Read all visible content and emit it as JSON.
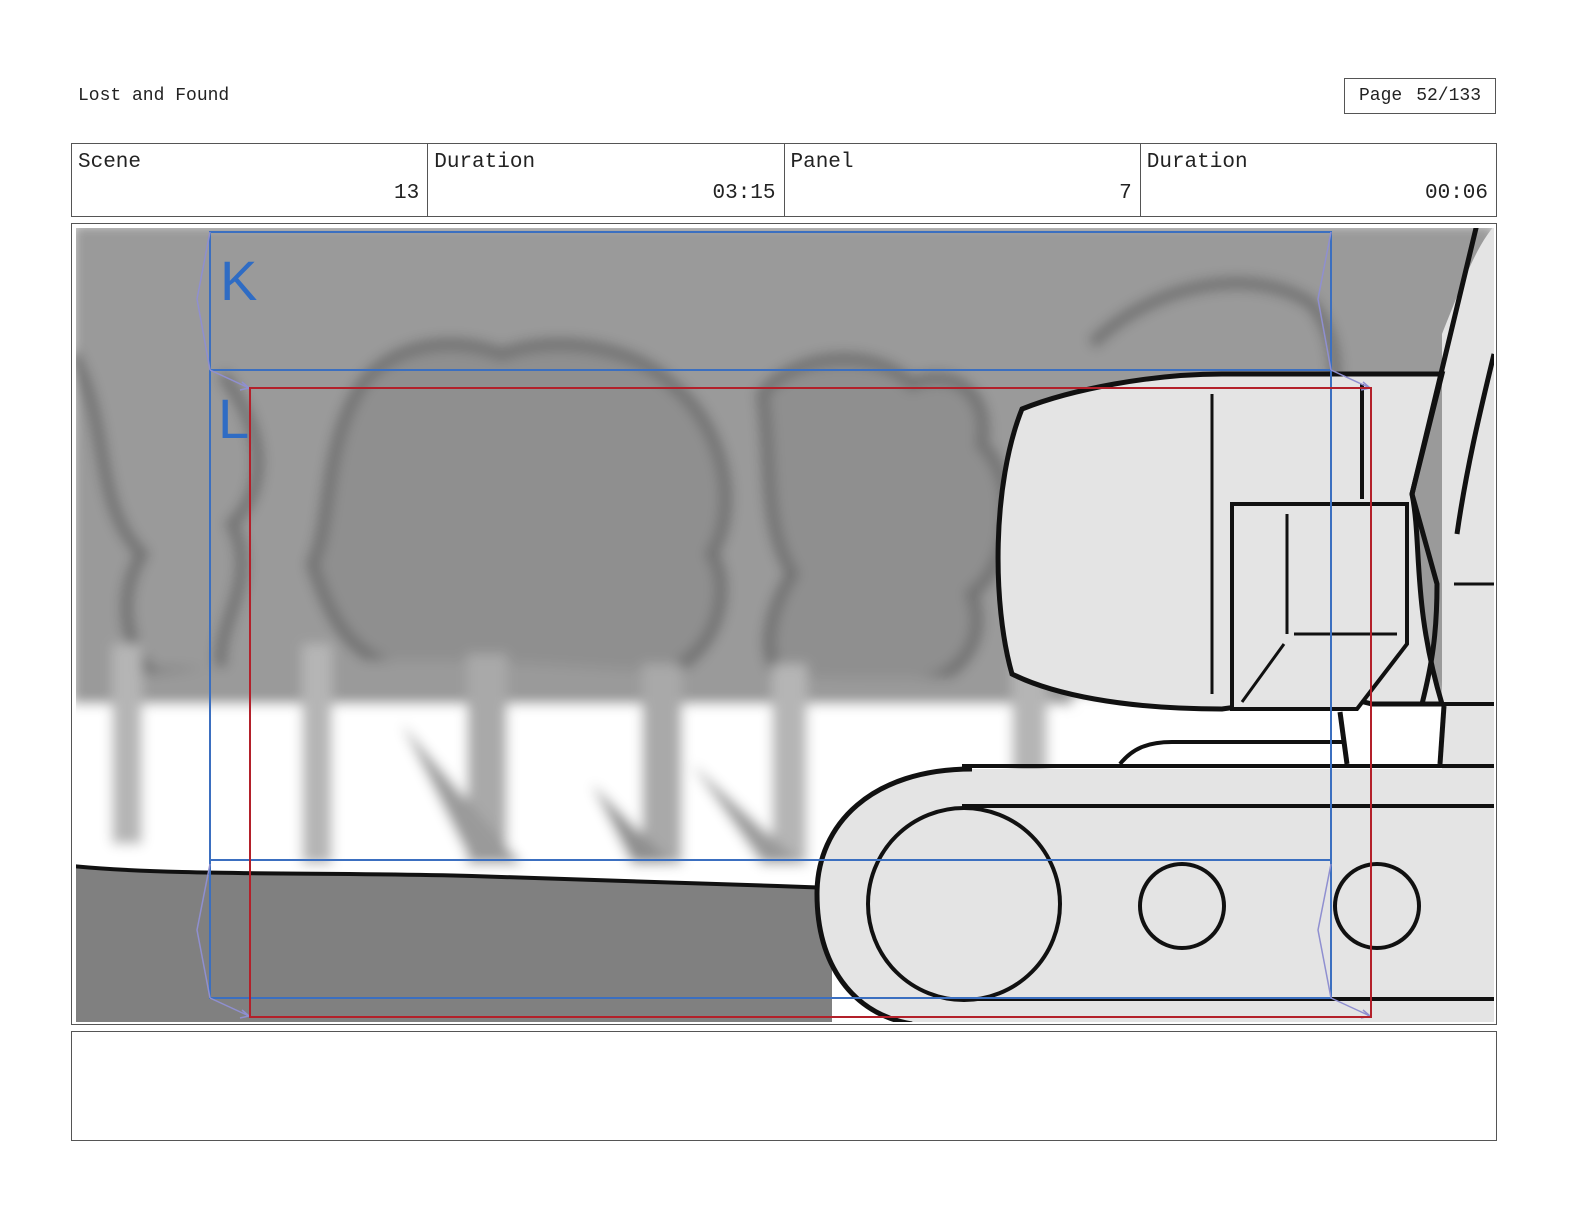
{
  "header": {
    "title": "Lost and Found",
    "page_label": "Page",
    "page_value": "52/133"
  },
  "info": {
    "scene_label": "Scene",
    "scene_value": "13",
    "scene_duration_label": "Duration",
    "scene_duration_value": "03:15",
    "panel_label": "Panel",
    "panel_value": "7",
    "panel_duration_label": "Duration",
    "panel_duration_value": "00:06"
  },
  "panel": {
    "camera_marks": [
      {
        "label": "K",
        "color": "#2f6cc4"
      },
      {
        "label": "L",
        "color": "#2f6cc4"
      }
    ],
    "frame_k_color": "#3b6fc0",
    "frame_l_color": "#b3202a"
  },
  "notes": {
    "text": ""
  }
}
